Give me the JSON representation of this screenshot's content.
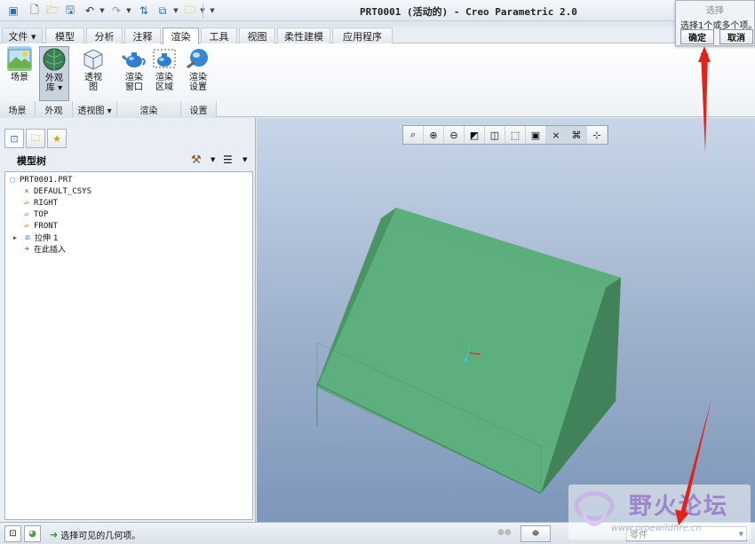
{
  "window_title": "PRT0001 (活动的) - Creo Parametric 2.0",
  "select_dialog": {
    "title": "选择",
    "message": "选择1个或多个项。",
    "ok_label": "确定",
    "cancel_label": "取消"
  },
  "ribbon_tabs": [
    {
      "label": "文件 ▾"
    },
    {
      "label": "模型"
    },
    {
      "label": "分析"
    },
    {
      "label": "注释"
    },
    {
      "label": "渲染"
    },
    {
      "label": "工具"
    },
    {
      "label": "视图"
    },
    {
      "label": "柔性建模"
    },
    {
      "label": "应用程序"
    }
  ],
  "ribbon_buttons": [
    {
      "label": "场景"
    },
    {
      "label": "外观\n库 ▾"
    },
    {
      "label": "透视\n图"
    },
    {
      "label": "渲染\n窗口"
    },
    {
      "label": "渲染\n区域"
    },
    {
      "label": "渲染\n设置"
    }
  ],
  "ribbon_groups": [
    {
      "label": "场景"
    },
    {
      "label": "外观"
    },
    {
      "label": "透视图 ▾"
    },
    {
      "label": "渲染"
    },
    {
      "label": "设置"
    }
  ],
  "model_tree": {
    "title": "模型树",
    "items": [
      {
        "label": "PRT0001.PRT"
      },
      {
        "label": "DEFAULT_CSYS"
      },
      {
        "label": "RIGHT"
      },
      {
        "label": "TOP"
      },
      {
        "label": "FRONT"
      },
      {
        "label": "拉伸 1"
      },
      {
        "label": "在此插入"
      }
    ]
  },
  "status": {
    "message": "选择可见的几何项。",
    "filter_value": "零件"
  },
  "watermark": {
    "title": "野火论坛",
    "url": "www.proewildfire.cn"
  },
  "colors": {
    "model_fill": "#4f9c6e",
    "model_face": "#5bad7a",
    "accent_red": "#e2231a",
    "viewport_top": "#c8d6e8",
    "viewport_bottom": "#7d97ba"
  }
}
